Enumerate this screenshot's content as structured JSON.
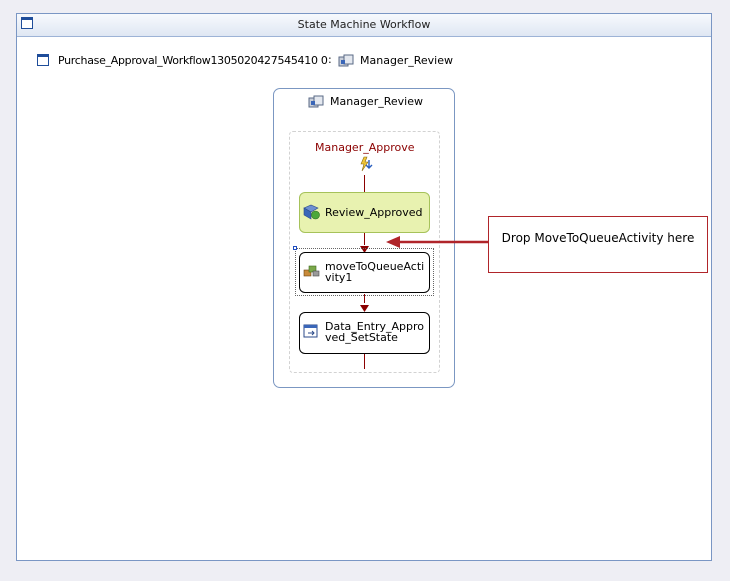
{
  "window": {
    "title": "State Machine Workflow"
  },
  "breadcrumb": {
    "workflow_name": "Purchase_Approval_Workflow1305020427545410 0",
    "separator": ":",
    "state_name": "Manager_Review"
  },
  "state": {
    "title": "Manager_Review",
    "event_driven": {
      "title": "Manager_Approve",
      "activities": [
        {
          "label": "Review_Approved"
        },
        {
          "label": "moveToQueueActi vity1"
        },
        {
          "label": "Data_Entry_Appro ved_SetState"
        }
      ]
    }
  },
  "callout": {
    "text": "Drop MoveToQueueActivity here"
  },
  "colors": {
    "connector": "#8b0000",
    "callout_border": "#b0252a",
    "highlight_fill": "#e8f2b0",
    "frame_border": "#7a96c4"
  }
}
